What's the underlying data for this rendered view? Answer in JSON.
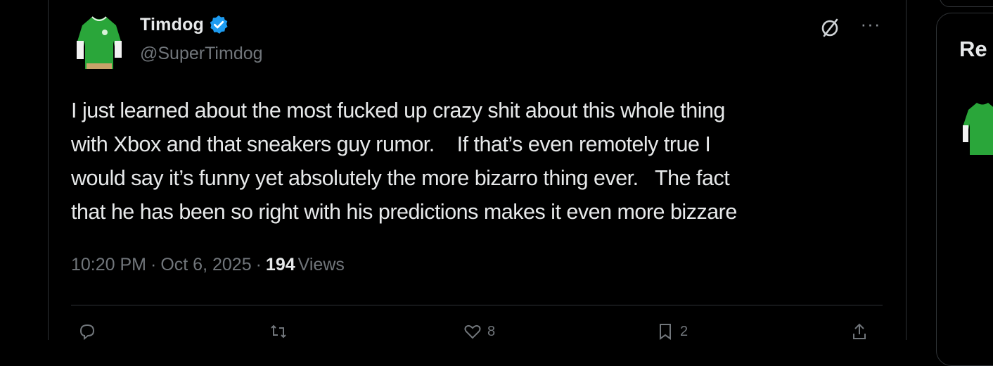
{
  "tweet": {
    "display_name": "Timdog",
    "handle": "@SuperTimdog",
    "verified": true,
    "text": "I just learned about the most fucked up crazy shit about this whole thing\nwith Xbox and that sneakers guy rumor.    If that’s even remotely true I\nwould say it’s funny yet absolutely the more bizarro thing ever.   The fact\nthat he has been so right with his predictions makes it even more bizzare",
    "time": "10:20 PM",
    "date": "Oct 6, 2025",
    "views_count": "194",
    "views_label": "Views",
    "actions": {
      "replies": "",
      "retweets": "",
      "likes": "8",
      "bookmarks": "2",
      "share": ""
    },
    "icons": [
      "verified-badge-icon",
      "grok-icon",
      "more-icon",
      "reply-icon",
      "retweet-icon",
      "like-icon",
      "bookmark-icon",
      "share-icon"
    ]
  },
  "right_column": {
    "title_partial": "Re"
  },
  "colors": {
    "background": "#000000",
    "text": "#e7e9ea",
    "secondary_text": "#71767b",
    "border": "#2f3336",
    "verified_blue": "#1d9bf0",
    "avatar_green": "#2aa63a"
  }
}
